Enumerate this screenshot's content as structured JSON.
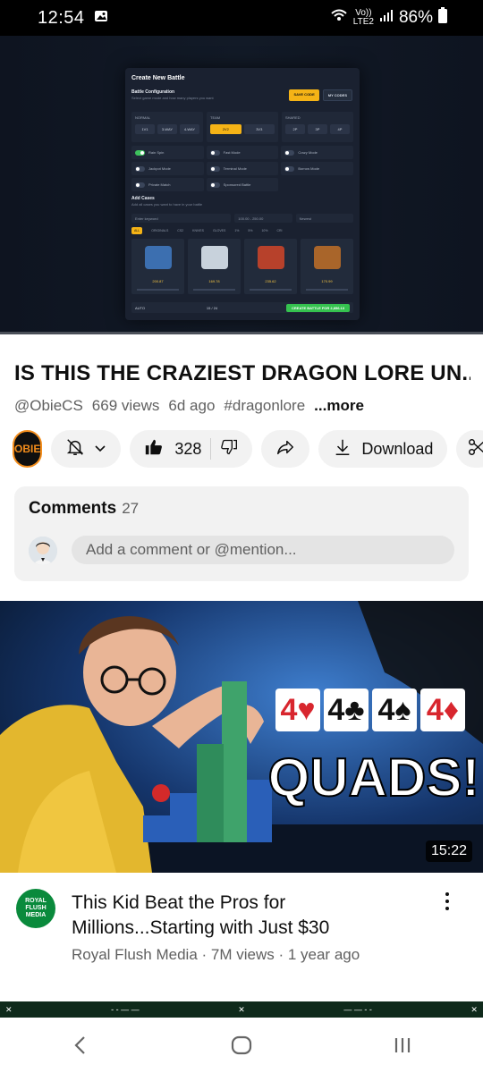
{
  "status": {
    "time": "12:54",
    "network_top": "Vo))",
    "network_bottom": "LTE2",
    "battery": "86%"
  },
  "player": {
    "modal": {
      "title": "Create New Battle",
      "subtitle": "Battle Configuration",
      "description": "Select game mode and how many players you want",
      "save_label": "SAVE CODE",
      "my_codes_label": "MY CODES",
      "modes": [
        {
          "head": "NORMAL",
          "options": [
            "1V1",
            "3-WAY",
            "4-WAY"
          ],
          "active": -1
        },
        {
          "head": "TEAM",
          "options": [
            "2V2",
            "3V3"
          ],
          "active": 0
        },
        {
          "head": "SHARED",
          "options": [
            "2P",
            "3P",
            "4P"
          ],
          "active": -1
        }
      ],
      "toggles": [
        "Rain Spin",
        "Fast Mode",
        "Crazy Mode",
        "Jackpot Mode",
        "Terminal Mode",
        "Borrow Mode",
        "Private Match",
        "Sponsored Battle"
      ],
      "add_cases_label": "Add Cases",
      "add_cases_desc": "Add all cases you want to have in your battle",
      "search_placeholder": "Enter keyword",
      "price_range": "100.00 - 250.00",
      "sort_by": "Newest",
      "categories": [
        "ALL",
        "ORIGINALS",
        "CS2",
        "KNIVES",
        "GLOVES",
        "1%",
        "5%",
        "10%",
        "CRI"
      ],
      "case_prices": [
        "200.87",
        "169.78",
        "235.62",
        "170.99"
      ],
      "footer_auto": "AUTO",
      "footer_count": "15 / 24",
      "create_label": "CREATE BATTLE FOR",
      "create_price": "2,856.13"
    },
    "progress": 0.0
  },
  "video": {
    "title": "IS THIS THE CRAZIEST DRAGON LORE UN...",
    "channel_handle": "@ObieCS",
    "views": "669 views",
    "age": "6d ago",
    "hashtag": "#dragonlore",
    "more_label": "...more",
    "channel_logo_text": "OBIE",
    "likes": "328",
    "download_label": "Download"
  },
  "comments": {
    "title": "Comments",
    "count": "27",
    "placeholder": "Add a comment or @mention..."
  },
  "recommended": {
    "duration": "15:22",
    "thumb_cards": [
      "4♥",
      "4♣",
      "4♠",
      "4♦"
    ],
    "thumb_text": "QUADS!",
    "title": "This Kid Beat the Pros for Millions...Starting with Just $30",
    "channel": "Royal Flush Media",
    "views": "7M views",
    "age": "1 year ago",
    "meta": "Royal Flush Media · 7M views · 1 year ago",
    "channel_logo_text": "ROYAL FLUSH MEDIA"
  },
  "colors": {
    "accent_yellow": "#f5b316",
    "create_green": "#35c24f",
    "youtube_red": "#ff0000"
  }
}
